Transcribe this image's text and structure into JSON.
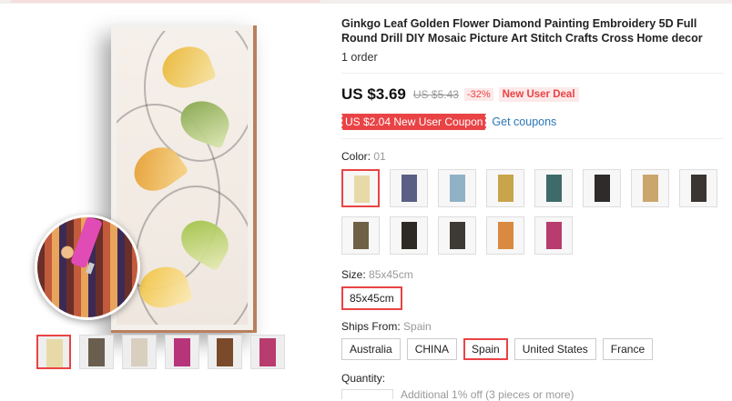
{
  "product": {
    "title": "Ginkgo Leaf Golden Flower Diamond Painting Embroidery 5D Full Round Drill DIY Mosaic Picture Art Stitch Crafts Cross Home decor",
    "orders": "1 order"
  },
  "price": {
    "current": "US $3.69",
    "original": "US $5.43",
    "discount": "-32%",
    "deal_badge": "New User Deal"
  },
  "coupon": {
    "label": "US $2.04 New User Coupon",
    "get_link": "Get coupons"
  },
  "color": {
    "label": "Color:",
    "selected": "01",
    "swatch_colors": [
      "#e8d9a8",
      "#5a5f84",
      "#8fb2c7",
      "#c8a44a",
      "#3e6b6a",
      "#2e2b2a",
      "#caa66c",
      "#3a3531",
      "#6f6145",
      "#2d2a26",
      "#3d3a35",
      "#d98a40",
      "#b83c6d"
    ]
  },
  "size": {
    "label": "Size:",
    "selected": "85x45cm",
    "options": [
      "85x45cm"
    ]
  },
  "ships_from": {
    "label": "Ships From:",
    "selected": "Spain",
    "options": [
      "Australia",
      "CHINA",
      "Spain",
      "United States",
      "France"
    ]
  },
  "quantity": {
    "label": "Quantity:",
    "note": "Additional 1% off (3 pieces or more)"
  },
  "gallery": {
    "thumb_colors": [
      "#e8d9a8",
      "#6a5e4f",
      "#d8cfbf",
      "#b8347a",
      "#7a4a2a",
      "#b83c6d"
    ]
  },
  "colors": {
    "accent": "#e94345",
    "link": "#2a76b6",
    "frame": "#b9805e"
  }
}
